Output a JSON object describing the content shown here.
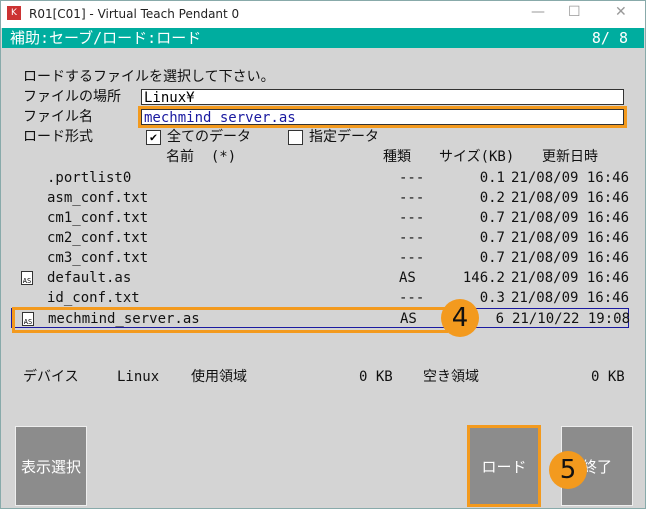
{
  "window": {
    "title": "R01[C01] - Virtual Teach Pendant 0",
    "app_icon": "K",
    "minimize": "—",
    "maximize": "☐",
    "close": "✕"
  },
  "header": {
    "title": "補助:セーブ/ロード:ロード",
    "page": "8/  8"
  },
  "form": {
    "instruction": "ロードするファイルを選択して下さい。",
    "location_label": "ファイルの場所",
    "location_value": "Linux¥",
    "filename_label": "ファイル名",
    "filename_value": "mechmind_server.as",
    "format_label": "ロード形式",
    "option_all": "全てのデータ",
    "option_all_checked": true,
    "option_specified": "指定データ",
    "option_specified_checked": false
  },
  "table": {
    "headers": {
      "name": "名前  (*)",
      "type": "種類",
      "size": "サイズ(KB)",
      "date": "更新日時"
    },
    "rows": [
      {
        "icon": false,
        "name": ".portlist0",
        "type": "---",
        "size": "0.1",
        "date": "21/08/09 16:46"
      },
      {
        "icon": false,
        "name": "asm_conf.txt",
        "type": "---",
        "size": "0.2",
        "date": "21/08/09 16:46"
      },
      {
        "icon": false,
        "name": "cm1_conf.txt",
        "type": "---",
        "size": "0.7",
        "date": "21/08/09 16:46"
      },
      {
        "icon": false,
        "name": "cm2_conf.txt",
        "type": "---",
        "size": "0.7",
        "date": "21/08/09 16:46"
      },
      {
        "icon": false,
        "name": "cm3_conf.txt",
        "type": "---",
        "size": "0.7",
        "date": "21/08/09 16:46"
      },
      {
        "icon": true,
        "name": "default.as",
        "type": "AS",
        "size": "146.2",
        "date": "21/08/09 16:46"
      },
      {
        "icon": false,
        "name": "id_conf.txt",
        "type": "---",
        "size": "0.3",
        "date": "21/08/09 16:46"
      },
      {
        "icon": true,
        "name": "mechmind_server.as",
        "type": "AS",
        "size": "6",
        "date": "21/10/22 19:08",
        "selected": true
      }
    ]
  },
  "status": {
    "device_label": "デバイス",
    "device": "Linux",
    "used_label": "使用領域",
    "used": "0 KB",
    "free_label": "空き領域",
    "free": "0 KB"
  },
  "buttons": {
    "display_select": "表示選択",
    "load": "ロード",
    "exit": "終了"
  },
  "callouts": {
    "step4": "4",
    "step5": "5"
  },
  "colors": {
    "header": "#00ad9f",
    "highlight": "#f39a1e",
    "selection": "#1a1aa0"
  }
}
